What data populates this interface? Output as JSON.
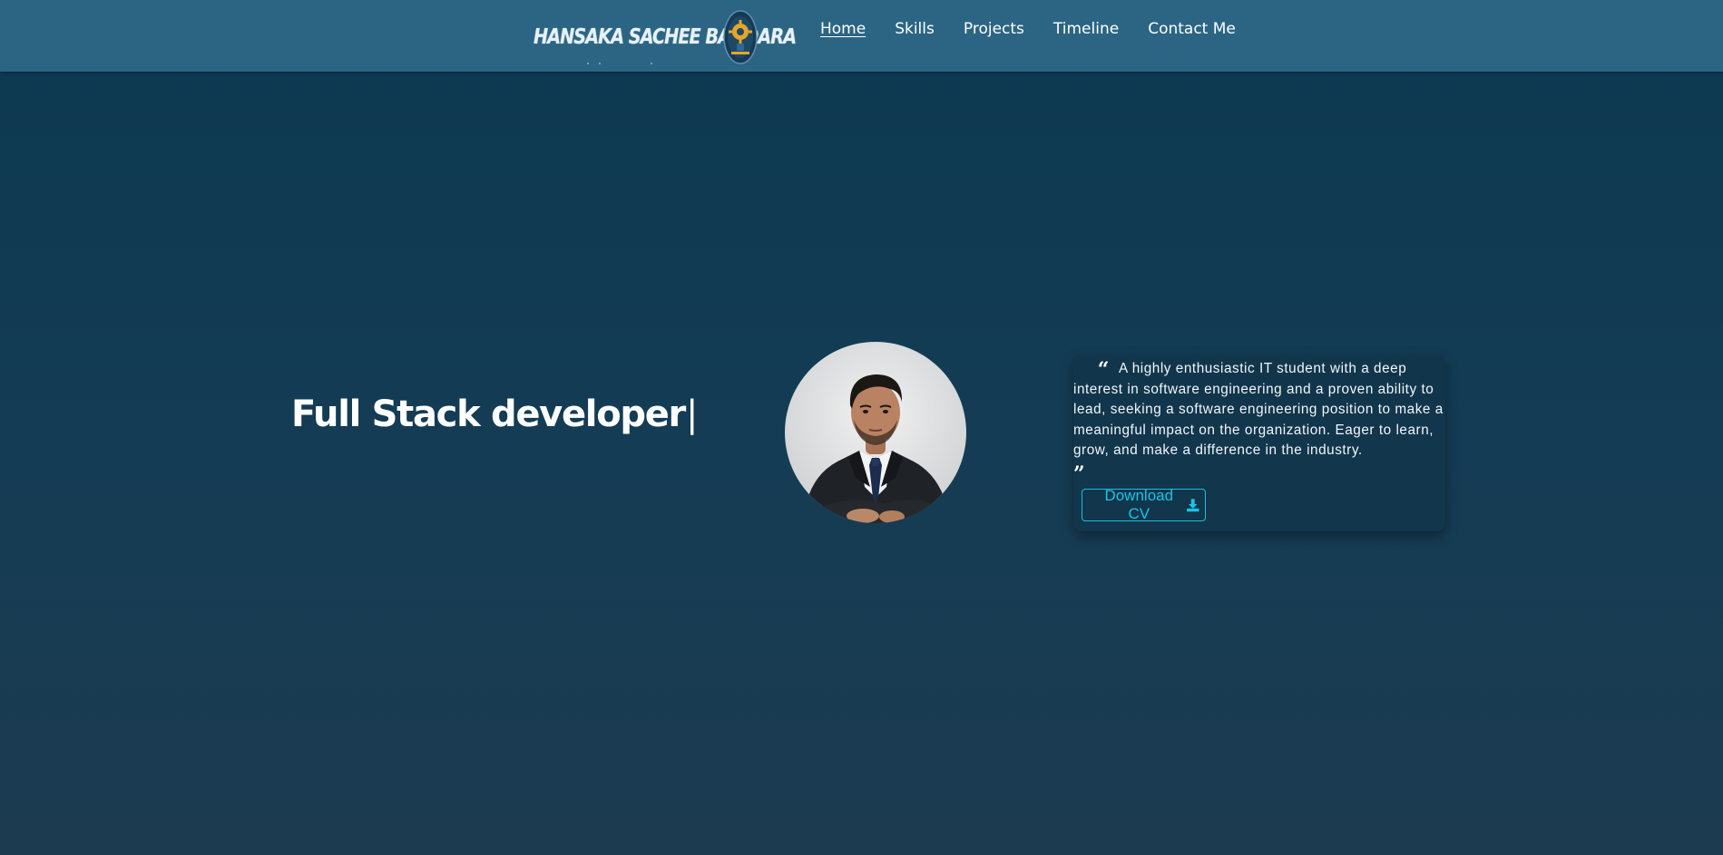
{
  "header": {
    "logo": {
      "text": "HANSAKA SACHEE BANDARA",
      "badge_icon": "gear-emblem-icon"
    },
    "nav": [
      {
        "label": "Home",
        "active": true
      },
      {
        "label": "Skills",
        "active": false
      },
      {
        "label": "Projects",
        "active": false
      },
      {
        "label": "Timeline",
        "active": false
      },
      {
        "label": "Contact Me",
        "active": false
      }
    ]
  },
  "hero": {
    "headline": "Full Stack developer",
    "cursor": "|",
    "avatar_icon": "profile-photo"
  },
  "about": {
    "quote_open": "“",
    "quote_close": "”",
    "text": "A highly enthusiastic IT student with a deep interest in software engineering and a proven ability to lead, seeking a software engineering position to make a meaningful impact on the organization. Eager to learn, grow, and make a difference in the industry.",
    "download_label": "Download CV",
    "download_icon": "download-icon"
  },
  "colors": {
    "navbar": "#2c6584",
    "background_top": "#0b3850",
    "background_bottom": "#1c3b51",
    "accent": "#18c4e8",
    "text": "#ffffff"
  }
}
